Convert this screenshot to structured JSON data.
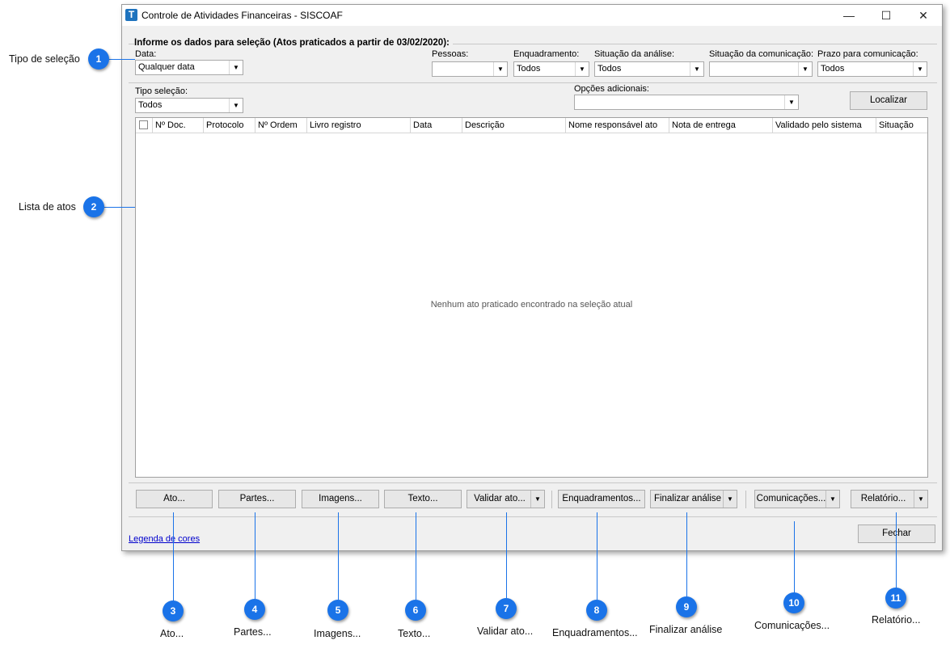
{
  "window": {
    "title": "Controle de Atividades Financeiras - SISCOAF",
    "icon_letter": "T",
    "controls": {
      "minimize": "—",
      "maximize": "☐",
      "close": "✕"
    }
  },
  "selection_group": {
    "title": "Informe os dados para seleção (Atos praticados a partir de 03/02/2020):",
    "data_label": "Data:",
    "data_value": "Qualquer data",
    "pessoas_label": "Pessoas:",
    "pessoas_value": "",
    "enquadramento_label": "Enquadramento:",
    "enquadramento_value": "Todos",
    "situacao_analise_label": "Situação da análise:",
    "situacao_analise_value": "Todos",
    "situacao_comunicacao_label": "Situação da comunicação:",
    "situacao_comunicacao_value": "",
    "prazo_label": "Prazo para comunicação:",
    "prazo_value": "Todos",
    "tipo_selecao_label": "Tipo seleção:",
    "tipo_selecao_value": "Todos",
    "opcoes_label": "Opções adicionais:",
    "opcoes_value": "",
    "localizar_label": "Localizar"
  },
  "grid": {
    "columns": [
      "Nº Doc.",
      "Protocolo",
      "Nº Ordem",
      "Livro registro",
      "Data",
      "Descrição",
      "Nome responsável ato",
      "Nota de entrega",
      "Validado pelo sistema",
      "Situação"
    ],
    "empty_message": "Nenhum ato praticado encontrado na seleção atual"
  },
  "buttons": {
    "ato": "Ato...",
    "partes": "Partes...",
    "imagens": "Imagens...",
    "texto": "Texto...",
    "validar": "Validar ato...",
    "enquadramentos": "Enquadramentos...",
    "finalizar": "Finalizar análise",
    "comunicacoes": "Comunicações...",
    "relatorio": "Relatório...",
    "fechar": "Fechar",
    "dropdown_arrow": "▼"
  },
  "legend_link": "Legenda de cores",
  "callouts": {
    "c1": {
      "num": "1",
      "text": "Tipo de seleção"
    },
    "c2": {
      "num": "2",
      "text": "Lista de atos"
    },
    "c3": {
      "num": "3",
      "text": "Ato..."
    },
    "c4": {
      "num": "4",
      "text": "Partes..."
    },
    "c5": {
      "num": "5",
      "text": "Imagens..."
    },
    "c6": {
      "num": "6",
      "text": "Texto..."
    },
    "c7": {
      "num": "7",
      "text": "Validar ato..."
    },
    "c8": {
      "num": "8",
      "text": "Enquadramentos..."
    },
    "c9": {
      "num": "9",
      "text": "Finalizar análise"
    },
    "c10": {
      "num": "10",
      "text": "Comunicações..."
    },
    "c11": {
      "num": "11",
      "text": "Relatório..."
    }
  },
  "colors": {
    "accent": "#1a73e8",
    "window_bg": "#f0f0f0",
    "link": "#0000cc"
  }
}
